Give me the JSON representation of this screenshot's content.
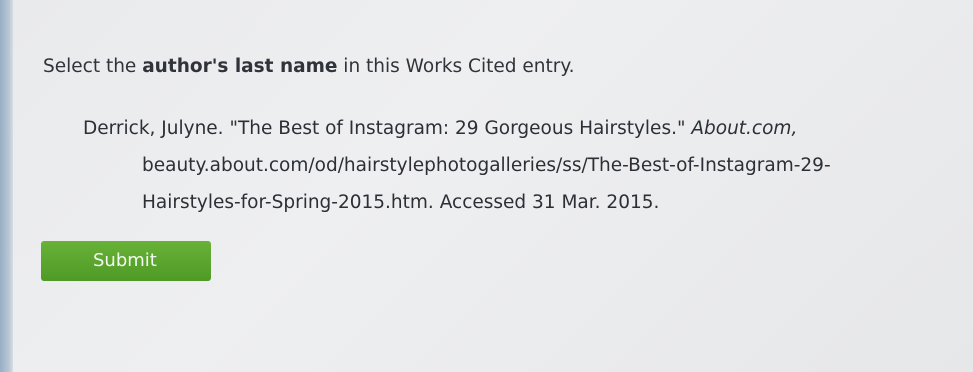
{
  "question": {
    "prefix": "Select the ",
    "bold": "author's last name",
    "suffix": " in this Works Cited entry."
  },
  "citation": {
    "author": "Derrick, Julyne.",
    "title": "\"The Best of Instagram: 29 Gorgeous Hairstyles.\"",
    "container": "About.com,",
    "url_line_1": "beauty.about.com/od/hairstylephotogalleries/ss/The-Best-of-Instagram-29-",
    "url_line_2": "Hairstyles-for-Spring-2015.htm. Accessed 31 Mar. 2015."
  },
  "submit": {
    "label": "Submit",
    "color": "#5aa52e"
  }
}
